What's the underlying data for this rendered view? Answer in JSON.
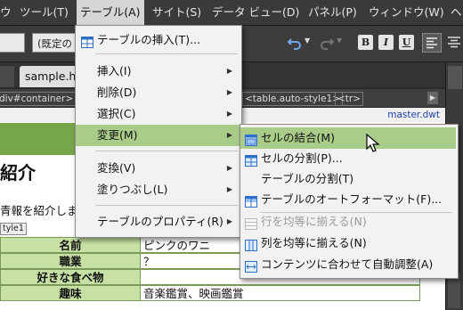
{
  "menubar": {
    "items": [
      {
        "label": "ウ"
      },
      {
        "label": "ツール(T)"
      },
      {
        "label": "テーブル(A)"
      },
      {
        "label": "サイト(S)"
      },
      {
        "label": "データ ビュー(D)"
      },
      {
        "label": "パネル(P)"
      },
      {
        "label": "ウィンドウ(W)"
      },
      {
        "label": "ヘ"
      }
    ]
  },
  "toolbar": {
    "style_select": "(既定の",
    "bold": "B",
    "italic": "I",
    "underline": "U"
  },
  "tabs": {
    "active": "sample.htm"
  },
  "tagpath": {
    "left": "div#container>",
    "table": "<table.auto-style1>",
    "tr": "<tr>"
  },
  "design": {
    "master_link": "master.dwt",
    "heading": "紹介",
    "intro": "青報を紹介しま",
    "style_tag": "tyle1",
    "table": [
      {
        "h": "名前",
        "v": "ピンクのワニ"
      },
      {
        "h": "職業",
        "v": "？"
      },
      {
        "h": "好きな食べ物",
        "v": ""
      },
      {
        "h": "趣味",
        "v": "音楽鑑賞、映画鑑賞"
      }
    ]
  },
  "table_menu": {
    "items": [
      {
        "label": "テーブルの挿入(T)..."
      },
      {
        "label": "挿入(I)"
      },
      {
        "label": "削除(D)"
      },
      {
        "label": "選択(C)"
      },
      {
        "label": "変更(M)"
      },
      {
        "label": "変換(V)"
      },
      {
        "label": "塗りつぶし(L)"
      },
      {
        "label": "テーブルのプロパティ(R)"
      }
    ]
  },
  "modify_menu": {
    "items": [
      {
        "label": "セルの結合(M)"
      },
      {
        "label": "セルの分割(P)..."
      },
      {
        "label": "テーブルの分割(T)"
      },
      {
        "label": "テーブルのオートフォーマット(F)..."
      },
      {
        "label": "行を均等に揃える(N)"
      },
      {
        "label": "列を均等に揃える(N)"
      },
      {
        "label": "コンテンツに合わせて自動調整(A)"
      }
    ]
  },
  "colors": {
    "menu_highlight": "#a9cc88",
    "table_header": "#c7e0a4",
    "green_band": "#76a54a"
  }
}
